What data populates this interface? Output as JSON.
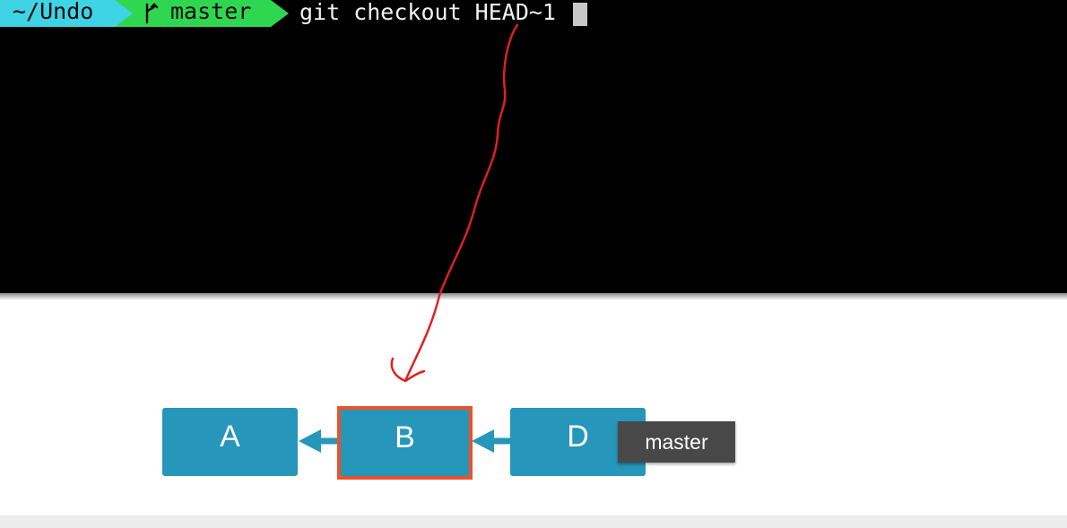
{
  "prompt": {
    "path": "~/Undo",
    "branch": "master",
    "command": "git checkout HEAD~1",
    "path_color": "#3fd3e6",
    "branch_color": "#2fd64f"
  },
  "diagram": {
    "commits": [
      {
        "id": "A",
        "highlighted": false
      },
      {
        "id": "B",
        "highlighted": true
      },
      {
        "id": "D",
        "highlighted": false
      }
    ],
    "branch_label": "master",
    "commit_color": "#2696ba",
    "highlight_color": "#e8532b",
    "annotation_color": "#e02020"
  }
}
